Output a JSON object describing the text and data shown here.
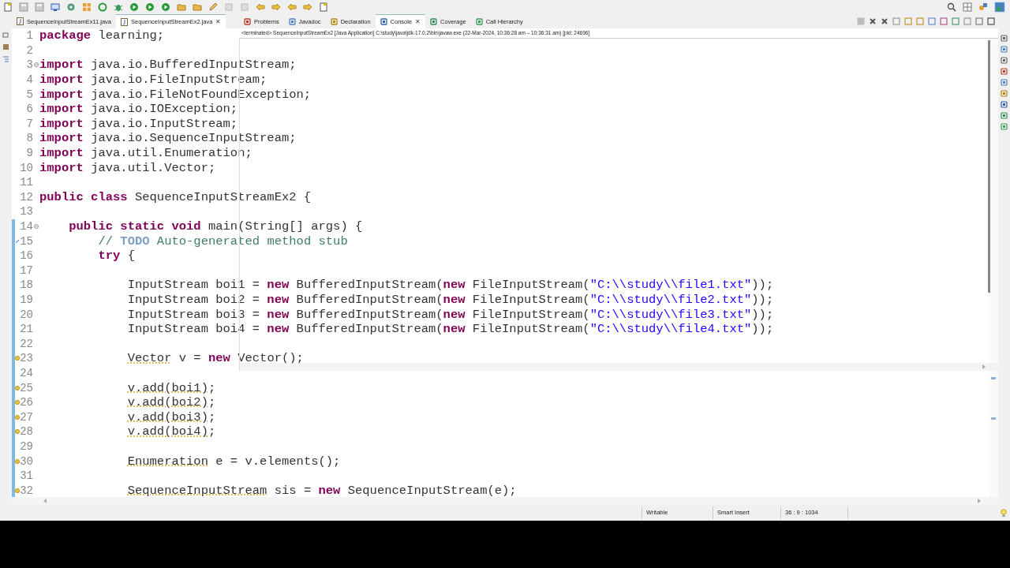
{
  "editor_tabs": [
    {
      "label": "SequenceInputStreamEx11.java",
      "selected": false
    },
    {
      "label": "SequenceInputStreamEx2.java",
      "selected": true,
      "close": "✕"
    }
  ],
  "console": {
    "tabs": [
      {
        "label": "Problems",
        "selected": false
      },
      {
        "label": "Javadoc",
        "selected": false
      },
      {
        "label": "Declaration",
        "selected": false
      },
      {
        "label": "Console",
        "selected": true,
        "close": "✕"
      },
      {
        "label": "Coverage",
        "selected": false
      },
      {
        "label": "Call Hierarchy",
        "selected": false
      }
    ],
    "header": "<terminated> SequenceInputStreamEx2 [Java Application] C:\\study\\java\\jdk-17.0.2\\bin\\javaw.exe  (22-Mar-2024, 10:36:28 am – 10:36:31 am) [pid: 24696]"
  },
  "code_lines": [
    {
      "number": "1",
      "kind": "plain",
      "marked": false,
      "fold": false,
      "tokens": [
        {
          "kind": "kw",
          "text": "package"
        },
        {
          "kind": "plain",
          "text": " learning;"
        }
      ]
    },
    {
      "number": "2",
      "kind": "plain",
      "marked": false,
      "fold": false
    },
    {
      "number": "3",
      "kind": "plain",
      "marked": false,
      "fold": true,
      "tokens": [
        {
          "kind": "kw",
          "text": "import"
        },
        {
          "kind": "plain",
          "text": " java.io.BufferedInputStream;"
        }
      ]
    },
    {
      "number": "4",
      "kind": "plain",
      "marked": false,
      "fold": false,
      "tokens": [
        {
          "kind": "kw",
          "text": "import"
        },
        {
          "kind": "plain",
          "text": " java.io.FileInputStream;"
        }
      ]
    },
    {
      "number": "5",
      "kind": "plain",
      "marked": false,
      "fold": false,
      "tokens": [
        {
          "kind": "kw",
          "text": "import"
        },
        {
          "kind": "plain",
          "text": " java.io.FileNotFoundException;"
        }
      ]
    },
    {
      "number": "6",
      "kind": "plain",
      "marked": false,
      "fold": false,
      "tokens": [
        {
          "kind": "kw",
          "text": "import"
        },
        {
          "kind": "plain",
          "text": " java.io.IOException;"
        }
      ]
    },
    {
      "number": "7",
      "kind": "plain",
      "marked": false,
      "fold": false,
      "tokens": [
        {
          "kind": "kw",
          "text": "import"
        },
        {
          "kind": "plain",
          "text": " java.io.InputStream;"
        }
      ]
    },
    {
      "number": "8",
      "kind": "plain",
      "marked": false,
      "fold": false,
      "tokens": [
        {
          "kind": "kw",
          "text": "import"
        },
        {
          "kind": "plain",
          "text": " java.io.SequenceInputStream;"
        }
      ]
    },
    {
      "number": "9",
      "kind": "plain",
      "marked": false,
      "fold": false,
      "tokens": [
        {
          "kind": "kw",
          "text": "import"
        },
        {
          "kind": "plain",
          "text": " java.util.Enumeration;"
        }
      ]
    },
    {
      "number": "10",
      "kind": "plain",
      "marked": false,
      "fold": false,
      "tokens": [
        {
          "kind": "kw",
          "text": "import"
        },
        {
          "kind": "plain",
          "text": " java.util.Vector;"
        }
      ]
    },
    {
      "number": "11",
      "kind": "plain",
      "marked": false,
      "fold": false
    },
    {
      "number": "12",
      "kind": "plain",
      "marked": false,
      "fold": false,
      "tokens": [
        {
          "kind": "kw",
          "text": "public class"
        },
        {
          "kind": "plain",
          "text": " SequenceInputStreamEx2 {"
        }
      ]
    },
    {
      "number": "13",
      "kind": "plain",
      "marked": false,
      "fold": false
    },
    {
      "number": "14",
      "kind": "plain",
      "marked": true,
      "fold": true,
      "tokens": [
        {
          "kind": "kw",
          "text": "    public static void"
        },
        {
          "kind": "plain",
          "text": " main(String[] args) {"
        }
      ]
    },
    {
      "number": "15",
      "kind": "task",
      "marked": true,
      "fold": false,
      "tokens": [
        {
          "kind": "comment",
          "text": "        // "
        },
        {
          "kind": "todo",
          "text": "TODO"
        },
        {
          "kind": "comment",
          "text": " Auto-generated method stub"
        }
      ]
    },
    {
      "number": "16",
      "kind": "plain",
      "marked": true,
      "fold": false,
      "tokens": [
        {
          "kind": "kw",
          "text": "        try"
        },
        {
          "kind": "plain",
          "text": " {"
        }
      ]
    },
    {
      "number": "17",
      "kind": "plain",
      "marked": true,
      "fold": false
    },
    {
      "number": "18",
      "kind": "plain",
      "marked": true,
      "fold": false,
      "tokens": [
        {
          "kind": "plain",
          "text": "            InputStream boi1 = "
        },
        {
          "kind": "kw",
          "text": "new"
        },
        {
          "kind": "plain",
          "text": " BufferedInputStream("
        },
        {
          "kind": "kw",
          "text": "new"
        },
        {
          "kind": "plain",
          "text": " FileInputStream("
        },
        {
          "kind": "string",
          "text": "\"C:\\\\study\\\\file1.txt\""
        },
        {
          "kind": "plain",
          "text": "));"
        }
      ]
    },
    {
      "number": "19",
      "kind": "plain",
      "marked": true,
      "fold": false,
      "tokens": [
        {
          "kind": "plain",
          "text": "            InputStream boi2 = "
        },
        {
          "kind": "kw",
          "text": "new"
        },
        {
          "kind": "plain",
          "text": " BufferedInputStream("
        },
        {
          "kind": "kw",
          "text": "new"
        },
        {
          "kind": "plain",
          "text": " FileInputStream("
        },
        {
          "kind": "string",
          "text": "\"C:\\\\study\\\\file2.txt\""
        },
        {
          "kind": "plain",
          "text": "));"
        }
      ]
    },
    {
      "number": "20",
      "kind": "plain",
      "marked": true,
      "fold": false,
      "tokens": [
        {
          "kind": "plain",
          "text": "            InputStream boi3 = "
        },
        {
          "kind": "kw",
          "text": "new"
        },
        {
          "kind": "plain",
          "text": " BufferedInputStream("
        },
        {
          "kind": "kw",
          "text": "new"
        },
        {
          "kind": "plain",
          "text": " FileInputStream("
        },
        {
          "kind": "string",
          "text": "\"C:\\\\study\\\\file3.txt\""
        },
        {
          "kind": "plain",
          "text": "));"
        }
      ]
    },
    {
      "number": "21",
      "kind": "plain",
      "marked": true,
      "fold": false,
      "tokens": [
        {
          "kind": "plain",
          "text": "            InputStream boi4 = "
        },
        {
          "kind": "kw",
          "text": "new"
        },
        {
          "kind": "plain",
          "text": " BufferedInputStream("
        },
        {
          "kind": "kw",
          "text": "new"
        },
        {
          "kind": "plain",
          "text": " FileInputStream("
        },
        {
          "kind": "string",
          "text": "\"C:\\\\study\\\\file4.txt\""
        },
        {
          "kind": "plain",
          "text": "));"
        }
      ]
    },
    {
      "number": "22",
      "kind": "plain",
      "marked": true,
      "fold": false
    },
    {
      "number": "23",
      "kind": "warning",
      "marked": true,
      "fold": false,
      "tokens": [
        {
          "kind": "warn",
          "text": "            Vector"
        },
        {
          "kind": "plain",
          "text": " v = "
        },
        {
          "kind": "kw",
          "text": "new"
        },
        {
          "kind": "plain",
          "text": " Vector();"
        }
      ]
    },
    {
      "number": "24",
      "kind": "plain",
      "marked": true,
      "fold": false
    },
    {
      "number": "25",
      "kind": "warning",
      "marked": true,
      "fold": false,
      "tokens": [
        {
          "kind": "warn",
          "text": "            v.add(boi1)"
        },
        {
          "kind": "plain",
          "text": ";"
        }
      ]
    },
    {
      "number": "26",
      "kind": "warning",
      "marked": true,
      "fold": false,
      "tokens": [
        {
          "kind": "warn",
          "text": "            v.add(boi2)"
        },
        {
          "kind": "plain",
          "text": ";"
        }
      ]
    },
    {
      "number": "27",
      "kind": "warning",
      "marked": true,
      "fold": false,
      "tokens": [
        {
          "kind": "warn",
          "text": "            v.add(boi3)"
        },
        {
          "kind": "plain",
          "text": ";"
        }
      ]
    },
    {
      "number": "28",
      "kind": "warning",
      "marked": true,
      "fold": false,
      "tokens": [
        {
          "kind": "warn",
          "text": "            v.add(boi4)"
        },
        {
          "kind": "plain",
          "text": ";"
        }
      ]
    },
    {
      "number": "29",
      "kind": "plain",
      "marked": true,
      "fold": false
    },
    {
      "number": "30",
      "kind": "warning",
      "marked": true,
      "fold": false,
      "tokens": [
        {
          "kind": "warn",
          "text": "            Enumeration"
        },
        {
          "kind": "plain",
          "text": " e = v.elements();"
        }
      ]
    },
    {
      "number": "31",
      "kind": "plain",
      "marked": true,
      "fold": false
    },
    {
      "number": "32",
      "kind": "warning",
      "marked": true,
      "fold": false,
      "tokens": [
        {
          "kind": "warn",
          "text": "            SequenceInputStream"
        },
        {
          "kind": "plain",
          "text": " sis = "
        },
        {
          "kind": "kw",
          "text": "new"
        },
        {
          "kind": "plain",
          "text": " SequenceInputStream(e);"
        }
      ]
    }
  ],
  "status_bar": {
    "fields": [
      "Writable",
      "Smart Insert",
      "36 : 9 : 1034"
    ]
  }
}
